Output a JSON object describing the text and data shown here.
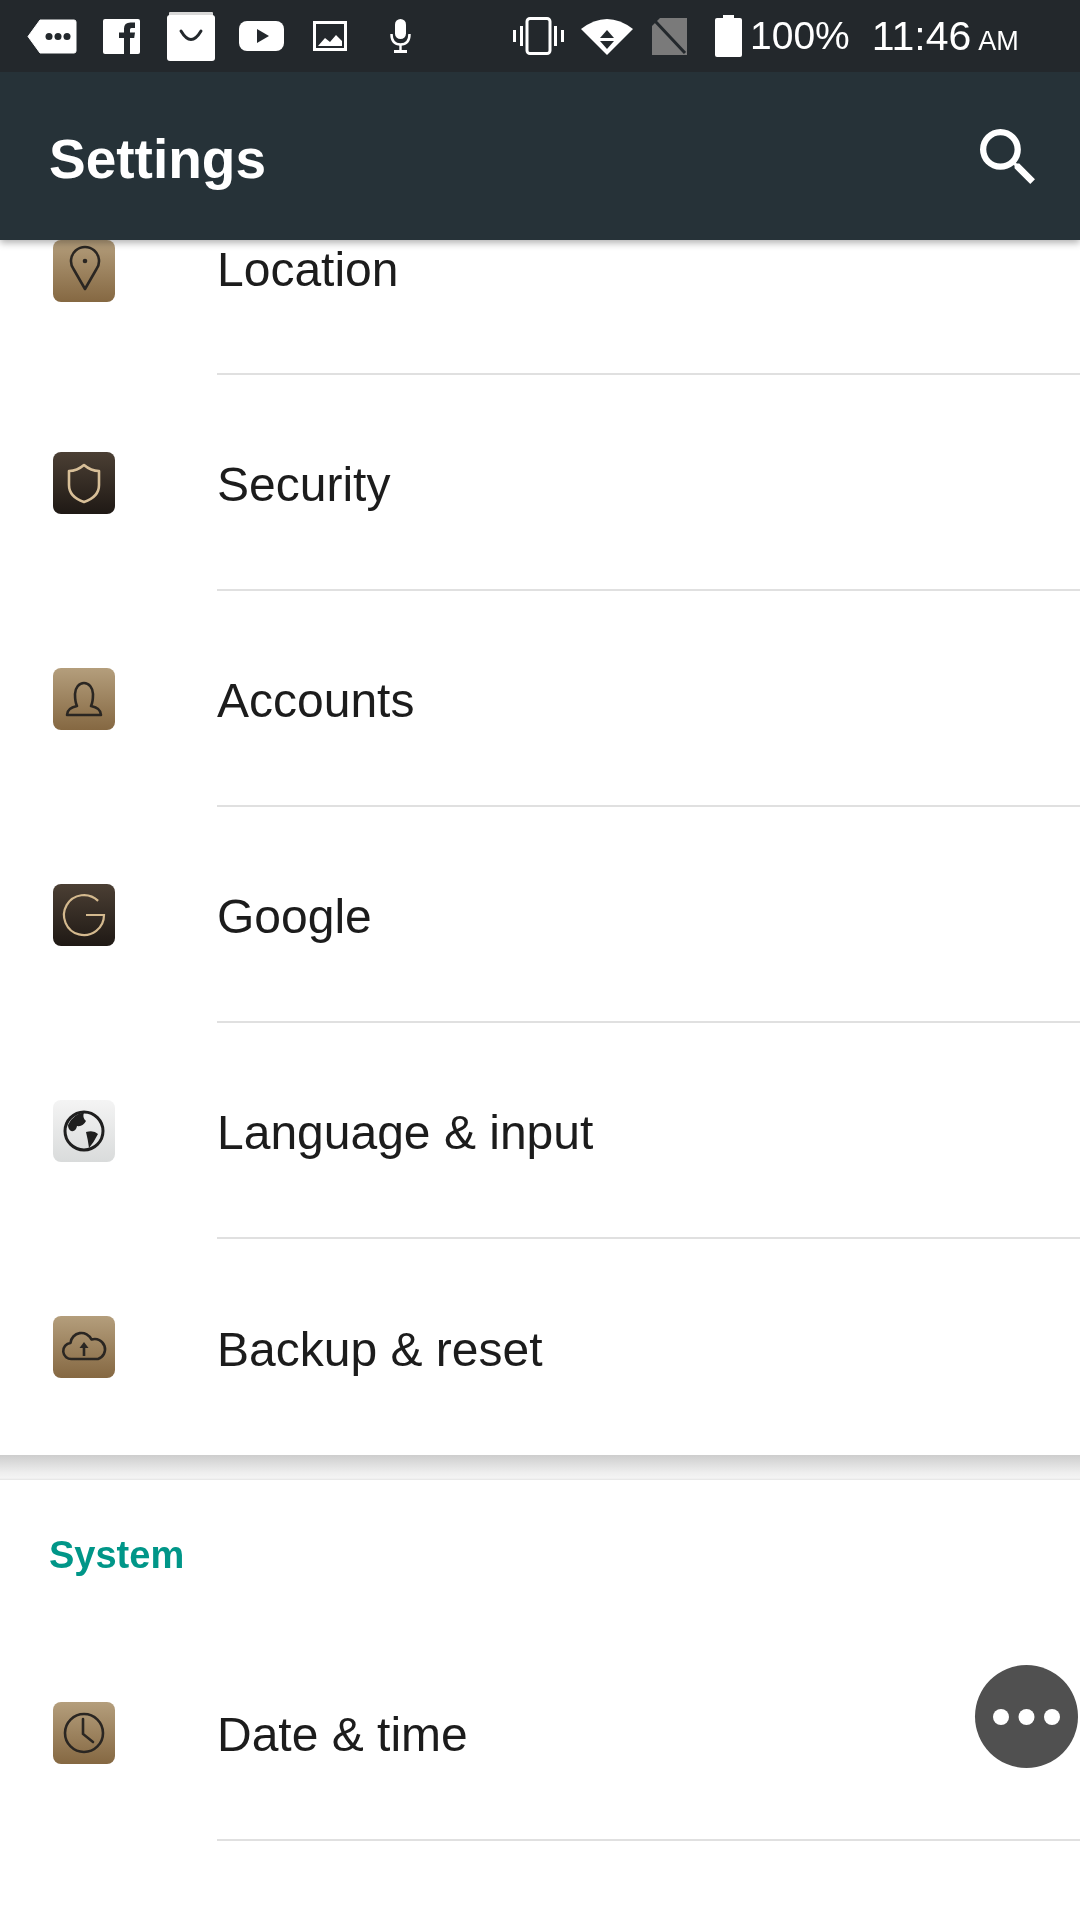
{
  "status_bar": {
    "battery": "100%",
    "time": "11:46",
    "meridiem": "AM"
  },
  "app_bar": {
    "title": "Settings"
  },
  "sections": [
    {
      "items": [
        {
          "label": "Location"
        },
        {
          "label": "Security"
        },
        {
          "label": "Accounts"
        },
        {
          "label": "Google"
        },
        {
          "label": "Language & input"
        },
        {
          "label": "Backup & reset"
        }
      ]
    },
    {
      "header": "System",
      "items": [
        {
          "label": "Date & time"
        }
      ]
    }
  ]
}
